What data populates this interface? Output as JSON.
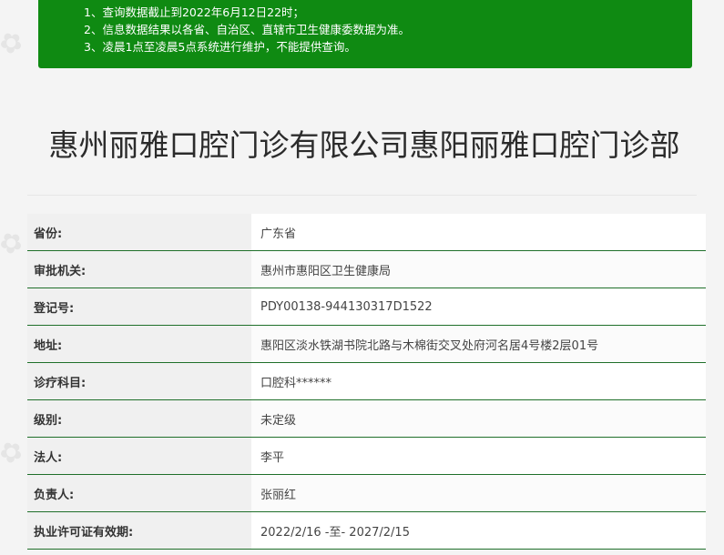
{
  "notice": {
    "lines": [
      "1、查询数据截止到2022年6月12日22时；",
      "2、信息数据结果以各省、自治区、直辖市卫生健康委数据为准。",
      "3、凌晨1点至凌晨5点系统进行维护，不能提供查询。"
    ]
  },
  "page_title": "惠州丽雅口腔门诊有限公司惠阳丽雅口腔门诊部",
  "details": [
    {
      "label": "省份:",
      "value": "广东省"
    },
    {
      "label": "审批机关:",
      "value": "惠州市惠阳区卫生健康局"
    },
    {
      "label": "登记号:",
      "value": "PDY00138-944130317D1522"
    },
    {
      "label": "地址:",
      "value": "惠阳区淡水铁湖书院北路与木棉街交叉处府河名居4号楼2层01号"
    },
    {
      "label": "诊疗科目:",
      "value": "口腔科******"
    },
    {
      "label": "级别:",
      "value": "未定级"
    },
    {
      "label": "法人:",
      "value": "李平"
    },
    {
      "label": "负责人:",
      "value": "张丽红"
    },
    {
      "label": "执业许可证有效期:",
      "value": "2022/2/16 -至- 2027/2/15"
    }
  ],
  "watermark": {
    "text": "美佳"
  }
}
